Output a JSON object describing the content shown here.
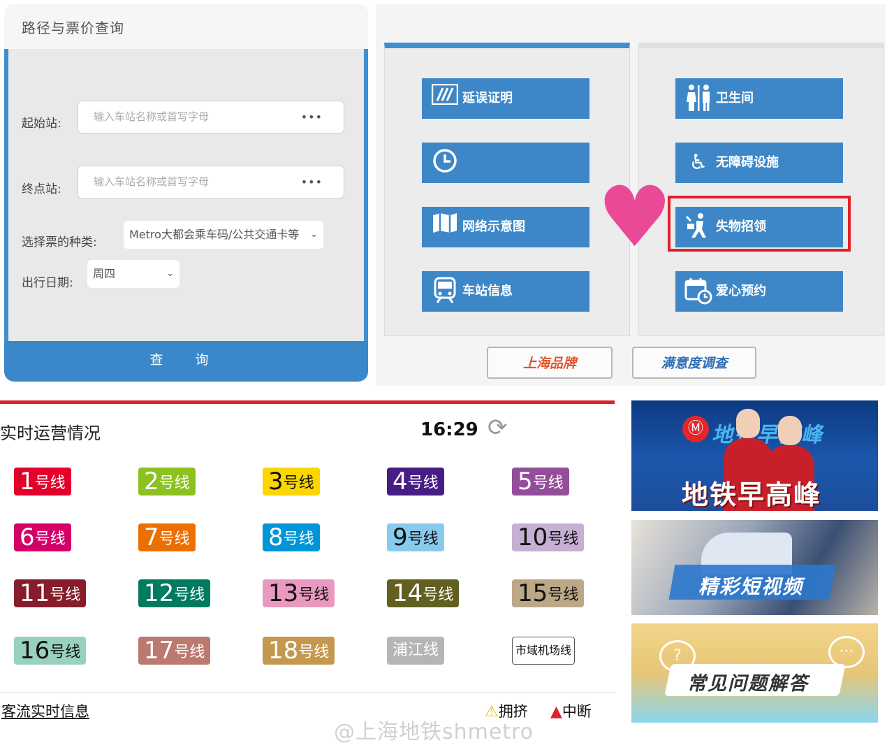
{
  "query": {
    "title": "路径与票价查询",
    "start_label": "起始站:",
    "end_label": "终点站:",
    "station_placeholder": "输入车站名称或首写字母",
    "more_dots": "•••",
    "ticket_type_label": "选择票的种类:",
    "ticket_type_value": "Metro大都会乘车码/公共交通卡等",
    "date_label": "出行日期:",
    "date_value": "周四",
    "submit_label": "查 询"
  },
  "services": {
    "left": [
      {
        "label": "延误证明",
        "icon": "delay-certificate-icon"
      },
      {
        "label": "",
        "icon": "clock-icon"
      },
      {
        "label": "网络示意图",
        "icon": "network-map-icon"
      },
      {
        "label": "车站信息",
        "icon": "train-icon"
      }
    ],
    "right": [
      {
        "label": "卫生间",
        "icon": "restroom-icon"
      },
      {
        "label": "无障碍设施",
        "icon": "wheelchair-icon"
      },
      {
        "label": "失物招领",
        "icon": "lost-and-found-icon"
      },
      {
        "label": "爱心预约",
        "icon": "calendar-icon"
      }
    ],
    "brand_button": "上海品牌",
    "survey_button": "满意度调查"
  },
  "ops": {
    "title": "实时运营情况",
    "time": "16:29",
    "lines": [
      {
        "num": "1",
        "suffix": "号线",
        "color": "#e3002b"
      },
      {
        "num": "2",
        "suffix": "号线",
        "color": "#8cc220"
      },
      {
        "num": "3",
        "suffix": "号线",
        "color": "#fcd600"
      },
      {
        "num": "4",
        "suffix": "号线",
        "color": "#461d84"
      },
      {
        "num": "5",
        "suffix": "号线",
        "color": "#944d9a"
      },
      {
        "num": "6",
        "suffix": "号线",
        "color": "#d40068"
      },
      {
        "num": "7",
        "suffix": "号线",
        "color": "#ed6f00"
      },
      {
        "num": "8",
        "suffix": "号线",
        "color": "#0094d8"
      },
      {
        "num": "9",
        "suffix": "号线",
        "color": "#87caed"
      },
      {
        "num": "10",
        "suffix": "号线",
        "color": "#c7afd3"
      },
      {
        "num": "11",
        "suffix": "号线",
        "color": "#871c2b"
      },
      {
        "num": "12",
        "suffix": "号线",
        "color": "#007a60"
      },
      {
        "num": "13",
        "suffix": "号线",
        "color": "#e999c0"
      },
      {
        "num": "14",
        "suffix": "号线",
        "color": "#626020"
      },
      {
        "num": "15",
        "suffix": "号线",
        "color": "#bca886"
      },
      {
        "num": "16",
        "suffix": "号线",
        "color": "#98d1c0"
      },
      {
        "num": "17",
        "suffix": "号线",
        "color": "#bb796f"
      },
      {
        "num": "18",
        "suffix": "号线",
        "color": "#c4984f"
      },
      {
        "num": "",
        "suffix": "浦江线",
        "color": "#b5b5b6"
      },
      {
        "num": "",
        "suffix": "市域机场线",
        "color": "#ffffff"
      }
    ],
    "flow_link": "客流实时信息",
    "legend_crowded": "拥挤",
    "legend_interrupted": "中断",
    "crowded_color": "#f2b705",
    "interrupted_color": "#e0202a"
  },
  "banners": {
    "b1_logo": "Ⓜ",
    "b1_sub": "地铁早高峰",
    "b1_main": "地铁早高峰",
    "b2_text": "精彩短视频",
    "b3_text": "常见问题解答",
    "b3_q": "?",
    "b3_dots": "···"
  },
  "watermark": "@上海地铁shmetro"
}
